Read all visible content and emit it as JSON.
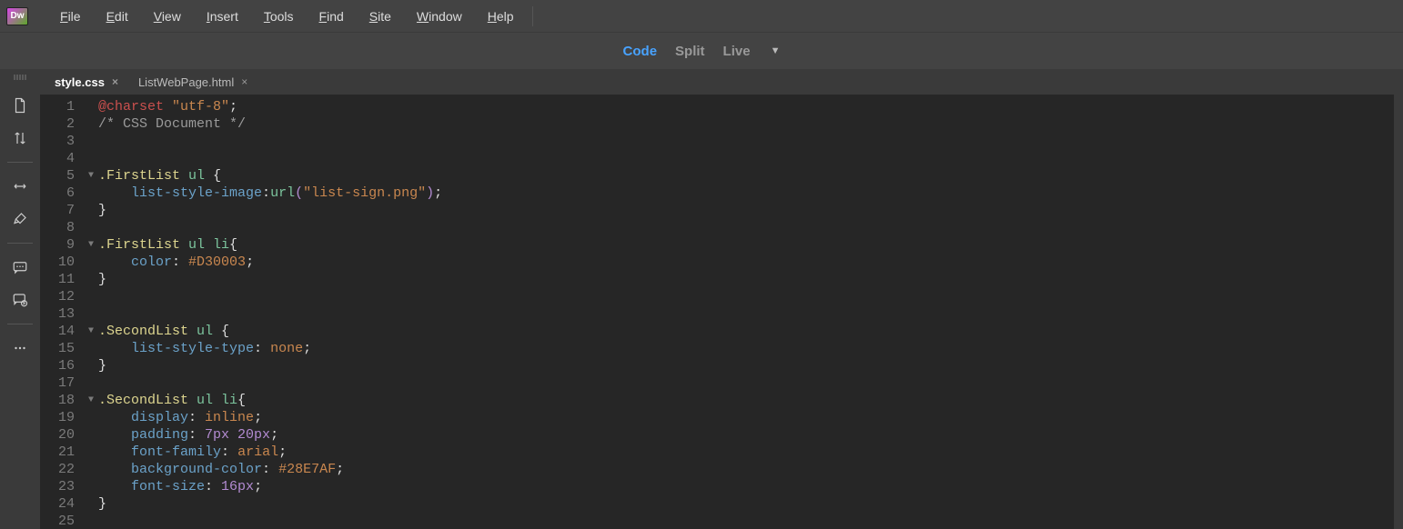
{
  "menu": {
    "items": [
      "File",
      "Edit",
      "View",
      "Insert",
      "Tools",
      "Find",
      "Site",
      "Window",
      "Help"
    ]
  },
  "viewModes": {
    "items": [
      "Code",
      "Split",
      "Live"
    ],
    "active": 0
  },
  "tabs": {
    "items": [
      {
        "label": "style.css",
        "active": true
      },
      {
        "label": "ListWebPage.html",
        "active": false
      }
    ]
  },
  "code": {
    "lines": [
      {
        "n": 1,
        "fold": "",
        "tokens": [
          [
            "t-keyword",
            "@charset "
          ],
          [
            "t-string",
            "\"utf-8\""
          ],
          [
            "t-punc",
            ";"
          ]
        ]
      },
      {
        "n": 2,
        "fold": "",
        "tokens": [
          [
            "t-comment",
            "/* CSS Document */"
          ]
        ]
      },
      {
        "n": 3,
        "fold": "",
        "tokens": []
      },
      {
        "n": 4,
        "fold": "",
        "tokens": []
      },
      {
        "n": 5,
        "fold": "▼",
        "tokens": [
          [
            "t-sel",
            ".FirstList "
          ],
          [
            "t-tag",
            "ul "
          ],
          [
            "t-punc",
            "{"
          ]
        ]
      },
      {
        "n": 6,
        "fold": "",
        "tokens": [
          [
            "",
            "    "
          ],
          [
            "t-prop",
            "list-style-image"
          ],
          [
            "t-punc",
            ":"
          ],
          [
            "t-tag",
            "url"
          ],
          [
            "t-punc2",
            "("
          ],
          [
            "t-string",
            "\"list-sign.png\""
          ],
          [
            "t-punc2",
            ")"
          ],
          [
            "t-punc",
            ";"
          ]
        ]
      },
      {
        "n": 7,
        "fold": "",
        "tokens": [
          [
            "t-punc",
            "}"
          ]
        ]
      },
      {
        "n": 8,
        "fold": "",
        "tokens": []
      },
      {
        "n": 9,
        "fold": "▼",
        "tokens": [
          [
            "t-sel",
            ".FirstList "
          ],
          [
            "t-tag",
            "ul li"
          ],
          [
            "t-punc",
            "{"
          ]
        ]
      },
      {
        "n": 10,
        "fold": "",
        "tokens": [
          [
            "",
            "    "
          ],
          [
            "t-prop",
            "color"
          ],
          [
            "t-punc",
            ": "
          ],
          [
            "t-val",
            "#D30003"
          ],
          [
            "t-punc",
            ";"
          ]
        ]
      },
      {
        "n": 11,
        "fold": "",
        "tokens": [
          [
            "t-punc",
            "}"
          ]
        ]
      },
      {
        "n": 12,
        "fold": "",
        "tokens": []
      },
      {
        "n": 13,
        "fold": "",
        "tokens": []
      },
      {
        "n": 14,
        "fold": "▼",
        "tokens": [
          [
            "t-sel",
            ".SecondList "
          ],
          [
            "t-tag",
            "ul "
          ],
          [
            "t-punc",
            "{"
          ]
        ]
      },
      {
        "n": 15,
        "fold": "",
        "tokens": [
          [
            "",
            "    "
          ],
          [
            "t-prop",
            "list-style-type"
          ],
          [
            "t-punc",
            ": "
          ],
          [
            "t-val",
            "none"
          ],
          [
            "t-punc",
            ";"
          ]
        ]
      },
      {
        "n": 16,
        "fold": "",
        "tokens": [
          [
            "t-punc",
            "}"
          ]
        ]
      },
      {
        "n": 17,
        "fold": "",
        "tokens": []
      },
      {
        "n": 18,
        "fold": "▼",
        "tokens": [
          [
            "t-sel",
            ".SecondList "
          ],
          [
            "t-tag",
            "ul li"
          ],
          [
            "t-punc",
            "{"
          ]
        ]
      },
      {
        "n": 19,
        "fold": "",
        "tokens": [
          [
            "",
            "    "
          ],
          [
            "t-prop",
            "display"
          ],
          [
            "t-punc",
            ": "
          ],
          [
            "t-val",
            "inline"
          ],
          [
            "t-punc",
            ";"
          ]
        ]
      },
      {
        "n": 20,
        "fold": "",
        "tokens": [
          [
            "",
            "    "
          ],
          [
            "t-prop",
            "padding"
          ],
          [
            "t-punc",
            ": "
          ],
          [
            "t-num",
            "7px 20px"
          ],
          [
            "t-punc",
            ";"
          ]
        ]
      },
      {
        "n": 21,
        "fold": "",
        "tokens": [
          [
            "",
            "    "
          ],
          [
            "t-prop",
            "font-family"
          ],
          [
            "t-punc",
            ": "
          ],
          [
            "t-val",
            "arial"
          ],
          [
            "t-punc",
            ";"
          ]
        ]
      },
      {
        "n": 22,
        "fold": "",
        "tokens": [
          [
            "",
            "    "
          ],
          [
            "t-prop",
            "background-color"
          ],
          [
            "t-punc",
            ": "
          ],
          [
            "t-val",
            "#28E7AF"
          ],
          [
            "t-punc",
            ";"
          ]
        ]
      },
      {
        "n": 23,
        "fold": "",
        "tokens": [
          [
            "",
            "    "
          ],
          [
            "t-prop",
            "font-size"
          ],
          [
            "t-punc",
            ": "
          ],
          [
            "t-num",
            "16px"
          ],
          [
            "t-punc",
            ";"
          ]
        ]
      },
      {
        "n": 24,
        "fold": "",
        "tokens": [
          [
            "t-punc",
            "}"
          ]
        ]
      },
      {
        "n": 25,
        "fold": "",
        "tokens": []
      }
    ]
  }
}
